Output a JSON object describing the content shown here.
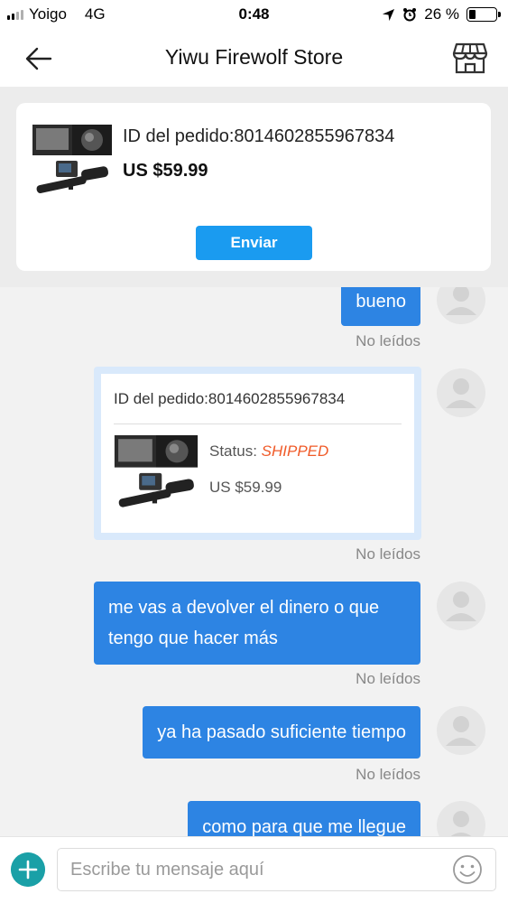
{
  "status_bar": {
    "carrier": "Yoigo",
    "network": "4G",
    "time": "0:48",
    "battery_percent": "26 %",
    "battery_level": 0.26
  },
  "header": {
    "title": "Yiwu Firewolf Store",
    "back_icon": "arrow-left-icon",
    "store_icon": "storefront-icon"
  },
  "order_card": {
    "order_id": "ID del pedido:8014602855967834",
    "price": "US $59.99",
    "send_label": "Enviar"
  },
  "messages": [
    {
      "text": "bueno",
      "status": "No leídos"
    },
    {
      "type": "order",
      "order_id": "ID del pedido:8014602855967834",
      "status_label": "Status:",
      "status_value": "SHIPPED",
      "price": "US $59.99",
      "status": "No leídos"
    },
    {
      "text": "me vas a devolver el dinero o que tengo que hacer más",
      "status": "No leídos"
    },
    {
      "text": "ya ha pasado suficiente tiempo",
      "status": "No leídos"
    },
    {
      "text": "como para que me llegue"
    }
  ],
  "input": {
    "placeholder": "Escribe tu mensaje aquí",
    "value": ""
  },
  "colors": {
    "accent": "#1a9bf0",
    "bubble": "#2d84e3",
    "shipped": "#f05a28",
    "plus_button": "#1aa0a7"
  }
}
